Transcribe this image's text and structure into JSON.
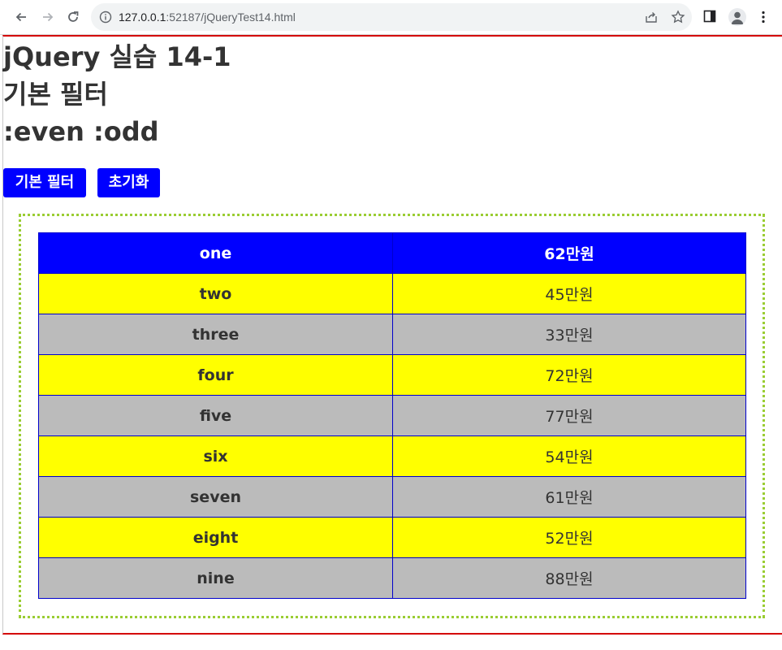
{
  "browser": {
    "url_host": "127.0.0.1",
    "url_rest": ":52187/jQueryTest14.html"
  },
  "page": {
    "title_line1": "jQuery 실습 14-1",
    "title_line2": "기본 필터",
    "title_line3": ":even :odd"
  },
  "buttons": {
    "filter_label": "기본 필터",
    "reset_label": "초기화"
  },
  "table": {
    "rows": [
      {
        "name": "one",
        "price": "62만원",
        "highlight": "first"
      },
      {
        "name": "two",
        "price": "45만원",
        "highlight": "odd"
      },
      {
        "name": "three",
        "price": "33만원",
        "highlight": "even"
      },
      {
        "name": "four",
        "price": "72만원",
        "highlight": "odd"
      },
      {
        "name": "five",
        "price": "77만원",
        "highlight": "even"
      },
      {
        "name": "six",
        "price": "54만원",
        "highlight": "odd"
      },
      {
        "name": "seven",
        "price": "61만원",
        "highlight": "even"
      },
      {
        "name": "eight",
        "price": "52만원",
        "highlight": "odd"
      },
      {
        "name": "nine",
        "price": "88만원",
        "highlight": "even"
      }
    ]
  },
  "colors": {
    "first_row": "#0000ff",
    "odd_rows": "#ffff00",
    "even_rows": "#bbbbbb",
    "button_bg": "#0000ff",
    "box_border": "#9acd32",
    "page_rule": "#d40000"
  }
}
